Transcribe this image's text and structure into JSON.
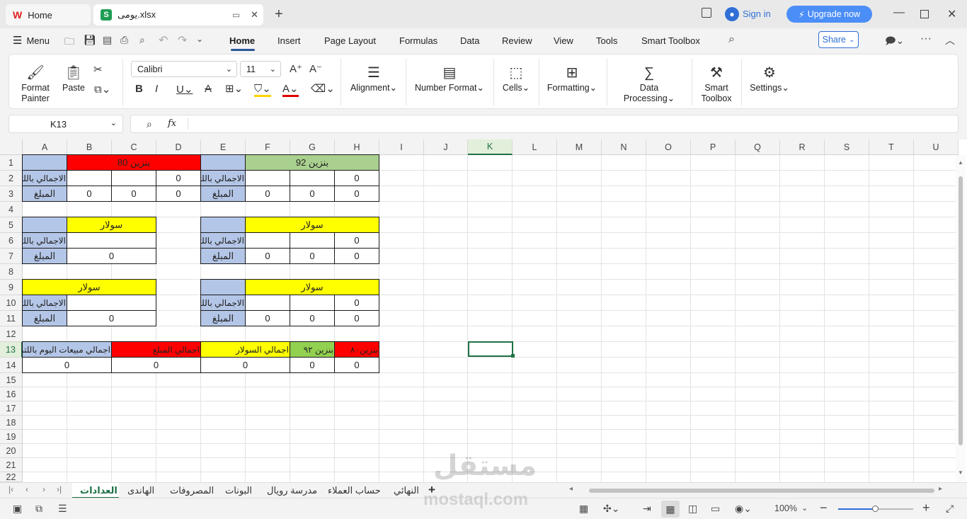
{
  "titlebar": {
    "home_tab": "Home",
    "file_tab": "يومى.xlsx",
    "sign_in": "Sign in",
    "upgrade": "Upgrade now"
  },
  "menubar": {
    "menu": "Menu",
    "tabs": [
      "Home",
      "Insert",
      "Page Layout",
      "Formulas",
      "Data",
      "Review",
      "View",
      "Tools",
      "Smart Toolbox"
    ],
    "share": "Share"
  },
  "ribbon": {
    "format_painter": "Format Painter",
    "paste": "Paste",
    "font_name": "Calibri",
    "font_size": "11",
    "alignment": "Alignment",
    "number_format": "Number Format",
    "cells": "Cells",
    "formatting": "Formatting",
    "data_processing": "Data Processing",
    "smart_toolbox": "Smart Toolbox",
    "settings": "Settings"
  },
  "formula_bar": {
    "name_box": "K13",
    "fx": "fx",
    "formula": ""
  },
  "columns": [
    "A",
    "B",
    "C",
    "D",
    "E",
    "F",
    "G",
    "H",
    "I",
    "J",
    "K",
    "L",
    "M",
    "N",
    "O",
    "P",
    "Q",
    "R",
    "S",
    "T",
    "U"
  ],
  "rows": [
    "1",
    "2",
    "3",
    "4",
    "5",
    "6",
    "7",
    "8",
    "9",
    "10",
    "11",
    "12",
    "13",
    "14",
    "15",
    "16",
    "17",
    "18",
    "19",
    "20",
    "21",
    "22"
  ],
  "cells": {
    "b80_header": "بنزين 80",
    "b92_header": "بنزين 92",
    "total_liters": "الاجمالي باللتر",
    "amount": "المبلغ",
    "diesel": "سولار",
    "zero": "0",
    "h_total_day": "اجمالي مبيعات اليوم باللتر",
    "h_total_amount": "اجمالي المبلغ",
    "h_total_diesel": "اجمالي السولار",
    "h_b92": "بنزين ٩٢",
    "h_b80": "بنزين٨٠"
  },
  "sheets": [
    "العدادات",
    "الهاندى",
    "المصروفات",
    "البونات",
    "مدرسة رويال",
    "حساب العملاء",
    "النهائي"
  ],
  "status": {
    "zoom": "100%"
  },
  "watermark": {
    "ar": "مستقل",
    "en": "mostaql.com"
  },
  "colors": {
    "red": "#ff0000",
    "green": "#a9d08e",
    "yellow": "#ffff00",
    "blue": "#b4c6e7",
    "bright_green": "#92d050",
    "accent": "#2b579a"
  }
}
